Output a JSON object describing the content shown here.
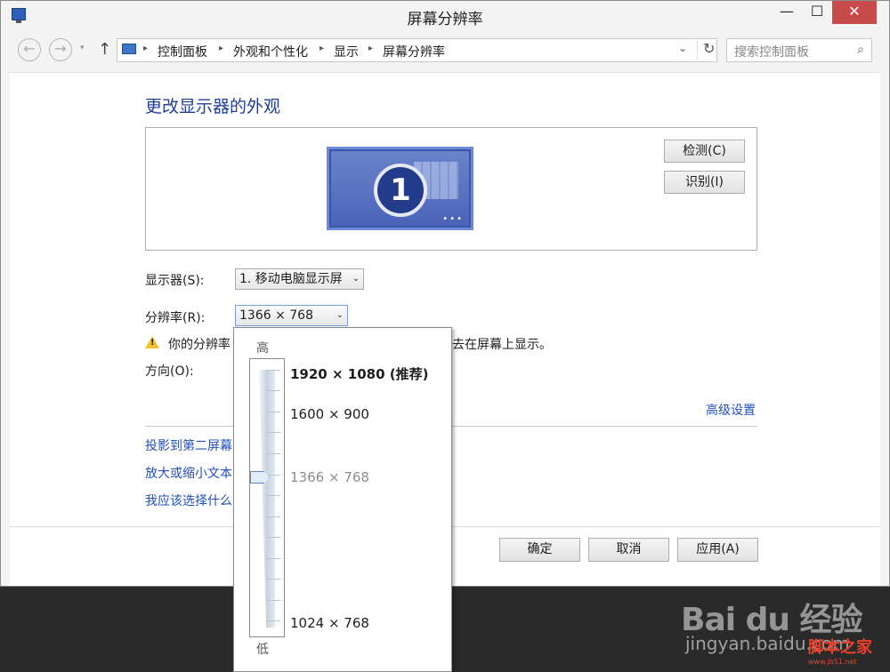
{
  "window": {
    "title": "屏幕分辨率",
    "minimize": "—",
    "maximize": "☐",
    "close": "✕"
  },
  "nav": {
    "back": "←",
    "forward": "→",
    "recent": "▾",
    "up": "↑",
    "breadcrumbs": [
      "控制面板",
      "外观和个性化",
      "显示",
      "屏幕分辨率"
    ],
    "separator": "▸",
    "refresh": "↻",
    "search_placeholder": "搜索控制面板",
    "search_icon": "magnifier-icon"
  },
  "main": {
    "heading": "更改显示器的外观",
    "monitor_number": "1",
    "detect_button": "检测(C)",
    "identify_button": "识别(I)",
    "display_label": "显示器(S):",
    "display_value": "1. 移动电脑显示屏",
    "resolution_label": "分辨率(R):",
    "resolution_value": "1366 × 768",
    "warning_text_a": "你的分辨率",
    "warning_text_b": "去在屏幕上显示。",
    "orientation_label": "方向(O):",
    "advanced_link": "高级设置",
    "links": [
      "投影到第二屏幕",
      "放大或缩小文本",
      "我应该选择什么"
    ],
    "ok_button": "确定",
    "cancel_button": "取消",
    "apply_button": "应用(A)"
  },
  "resolution_popup": {
    "high_label": "高",
    "low_label": "低",
    "options": [
      "1920 × 1080 (推荐)",
      "1600 × 900",
      "1366 × 768",
      "1024 × 768"
    ],
    "selected": "1366 × 768"
  },
  "watermark": {
    "logo": "Bai du 经验",
    "url": "jingyan.baidu.com",
    "site": "脚本之家",
    "site_url": "www.jb51.net"
  }
}
